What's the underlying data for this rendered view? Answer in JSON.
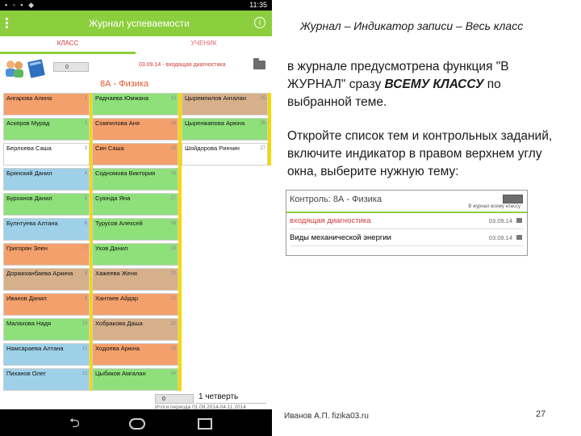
{
  "tablet": {
    "status_time": "11:35",
    "app_title": "Журнал успеваемости",
    "tabs": {
      "class": "КЛАСС",
      "student": "УЧЕНИК"
    },
    "small_select": "0",
    "topic_line": "03.09.14 - входящая диагностика",
    "subject": "8А - Физика",
    "students_left": [
      {
        "name": "Ангарова Алина",
        "num": "1",
        "color": "#f4a06c"
      },
      {
        "name": "Аскеров Мурад",
        "num": "2",
        "color": "#8ee07a"
      },
      {
        "name": "Берлоева Саша",
        "num": "3",
        "color": "#ffffff"
      },
      {
        "name": "Брянский Данил",
        "num": "4",
        "color": "#9ed0e8"
      },
      {
        "name": "Бурханов Данил",
        "num": "5",
        "color": "#8ee07a"
      },
      {
        "name": "Булнтуева Алтана",
        "num": "6",
        "color": "#9ed0e8"
      },
      {
        "name": "Григорян Элен",
        "num": "7",
        "color": "#f4a06c"
      },
      {
        "name": "Доржиханбаева Аркина",
        "num": "8",
        "color": "#d6b08a"
      },
      {
        "name": "Иванов Данил",
        "num": "9",
        "color": "#f4a06c"
      },
      {
        "name": "Малахова Надя",
        "num": "10",
        "color": "#8ee07a"
      },
      {
        "name": "Намсараева Алтана",
        "num": "11",
        "color": "#9ed0e8"
      },
      {
        "name": "Пиханов Олег",
        "num": "12",
        "color": "#9ed0e8"
      }
    ],
    "students_middle": [
      {
        "name": "Раднаева Юмжана",
        "num": "13",
        "color": "#8ee07a"
      },
      {
        "name": "Сомпилова Аня",
        "num": "14",
        "color": "#f4a06c"
      },
      {
        "name": "Син Саша",
        "num": "15",
        "color": "#f4a06c"
      },
      {
        "name": "Содномова Виктория",
        "num": "16",
        "color": "#8ee07a"
      },
      {
        "name": "Суюнда Яна",
        "num": "17",
        "color": "#8ee07a"
      },
      {
        "name": "Турусов Алексей",
        "num": "18",
        "color": "#8ee07a"
      },
      {
        "name": "Ухов Данил",
        "num": "19",
        "color": "#8ee07a"
      },
      {
        "name": "Хажеева Женя",
        "num": "20",
        "color": "#d6b08a"
      },
      {
        "name": "Хантаев Айдар",
        "num": "21",
        "color": "#f4a06c"
      },
      {
        "name": "Хобракова Даша",
        "num": "22",
        "color": "#d6b08a"
      },
      {
        "name": "Ходоева Арюна",
        "num": "23",
        "color": "#f4a06c"
      },
      {
        "name": "Цыбиков Амгалан",
        "num": "24",
        "color": "#8ee07a"
      }
    ],
    "students_right": [
      {
        "name": "Цыремпилов Ангалан",
        "num": "25",
        "color": "#d6b08a"
      },
      {
        "name": "Цыренжапова Арюна",
        "num": "26",
        "color": "#8ee07a"
      },
      {
        "name": "Шойдорова Ринчин",
        "num": "27",
        "color": "#ffffff"
      }
    ],
    "bottom_select": "0",
    "quarter": "1 четверть",
    "period": "Итоги периода   01.09.2014-04.11.2014"
  },
  "slide": {
    "title": "Журнал – Индикатор записи – Весь класс",
    "para1_a": "в журнале предусмотрена функция \"В ЖУРНАЛ\" сразу ",
    "para1_b": "ВСЕМУ КЛАССУ",
    "para1_c": " по выбранной теме.",
    "para2": "Откройте список тем и контрольных заданий, включите индикатор в правом верхнем углу окна, выберите нужную тему:",
    "shot": {
      "title": "Контроль: 8А - Физика",
      "sub": "В журнал всему классу",
      "rows": [
        {
          "label": "входящая диагностика",
          "date": "03.09.14",
          "color": "#d03a3a"
        },
        {
          "label": "Виды механической энергии",
          "date": "03.09.14",
          "color": "#333333"
        }
      ]
    },
    "footer": "Иванов А.П. fizika03.ru",
    "page_number": "27"
  }
}
